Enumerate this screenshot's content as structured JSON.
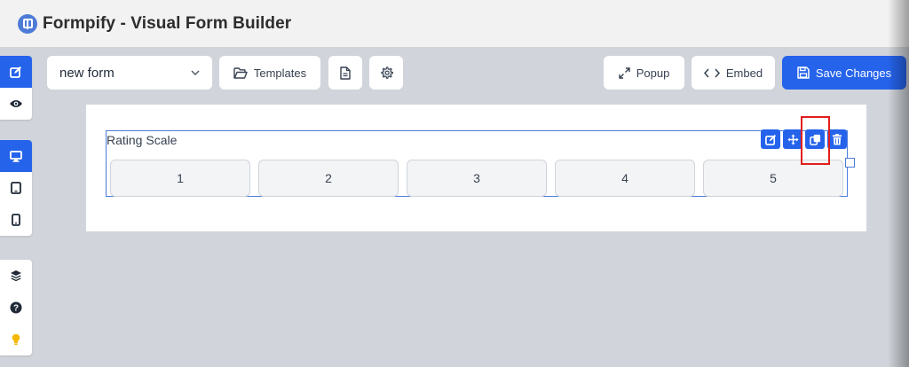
{
  "app": {
    "title": "Formpify - Visual Form Builder"
  },
  "toolbar": {
    "form_select_value": "new form",
    "templates_label": "Templates",
    "popup_label": "Popup",
    "embed_label": "Embed",
    "save_label": "Save Changes"
  },
  "sidebar": {
    "groups": [
      [
        "edit-icon",
        "preview-eye-icon"
      ],
      [
        "desktop-icon",
        "tablet-icon",
        "mobile-icon"
      ],
      [
        "layers-icon",
        "help-icon",
        "lightbulb-icon"
      ]
    ]
  },
  "field": {
    "label": "Rating Scale",
    "options": [
      "1",
      "2",
      "3",
      "4",
      "5"
    ],
    "actions": [
      "edit-icon",
      "move-icon",
      "duplicate-icon",
      "delete-icon"
    ]
  },
  "colors": {
    "accent": "#2563eb",
    "highlight": "#e21d1d",
    "canvas_bg": "#d1d5db"
  }
}
